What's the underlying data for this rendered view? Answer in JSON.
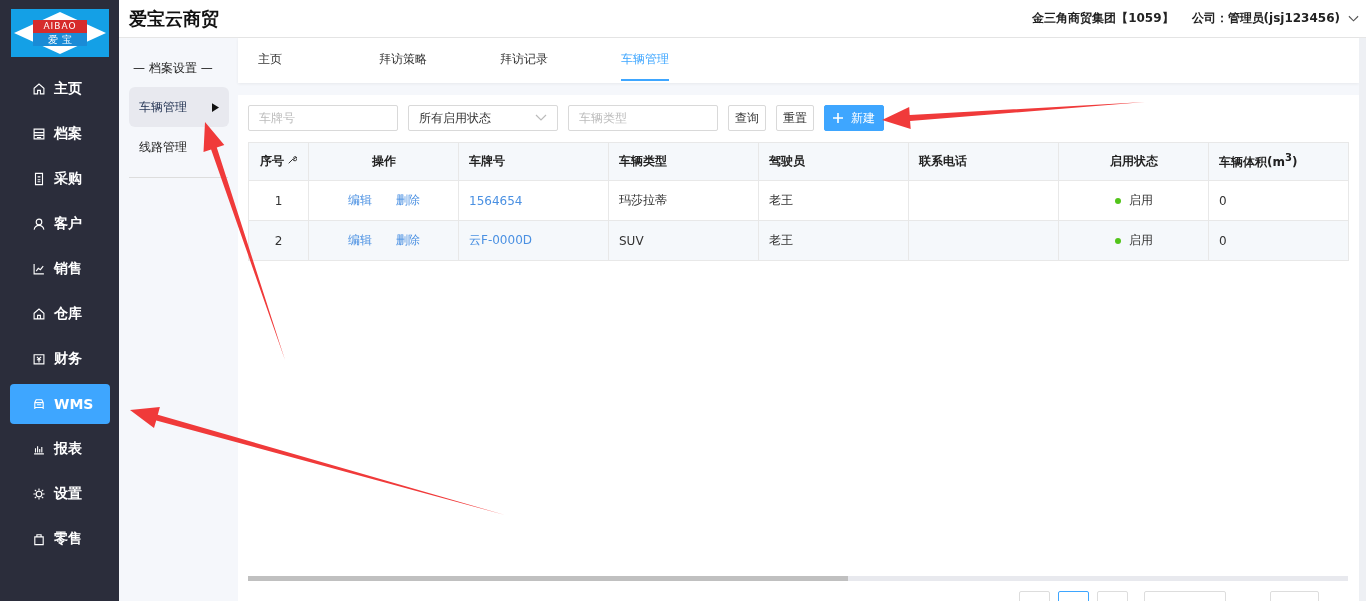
{
  "app_title": "爱宝云商贸",
  "logo": {
    "top": "AIBAO",
    "bottom": "爱 宝"
  },
  "header": {
    "company": "金三角商贸集团【1059】",
    "user": "公司：管理员(jsj123456)"
  },
  "nav": [
    {
      "label": "主页",
      "selected": false
    },
    {
      "label": "档案",
      "selected": false
    },
    {
      "label": "采购",
      "selected": false
    },
    {
      "label": "客户",
      "selected": false
    },
    {
      "label": "销售",
      "selected": false
    },
    {
      "label": "仓库",
      "selected": false
    },
    {
      "label": "财务",
      "selected": false
    },
    {
      "label": "WMS",
      "selected": true
    },
    {
      "label": "报表",
      "selected": false
    },
    {
      "label": "设置",
      "selected": false
    },
    {
      "label": "零售",
      "selected": false
    }
  ],
  "subnav": {
    "heading": "— 档案设置 —",
    "items": [
      {
        "label": "车辆管理",
        "selected": true
      },
      {
        "label": "线路管理",
        "selected": false
      }
    ]
  },
  "tabs": [
    {
      "label": "主页",
      "selected": false
    },
    {
      "label": "拜访策略",
      "selected": false
    },
    {
      "label": "拜访记录",
      "selected": false
    },
    {
      "label": "车辆管理",
      "selected": true
    }
  ],
  "filters": {
    "plate": {
      "placeholder": "车牌号"
    },
    "status": {
      "value": "所有启用状态"
    },
    "type": {
      "placeholder": "车辆类型"
    },
    "buttons": [
      "查询",
      "重置"
    ],
    "new_button": "新建"
  },
  "table": {
    "columns": [
      "序号",
      "操作",
      "车牌号",
      "车辆类型",
      "驾驶员",
      "联系电话",
      "启用状态",
      "车辆体积(m$^{3}$)"
    ],
    "rows": [
      {
        "index": "1",
        "actions": [
          "编辑",
          "删除"
        ],
        "plate": "1564654",
        "type": "玛莎拉蒂",
        "driver": "老王",
        "status": {
          "label": "启用",
          "color": "#52c41a"
        },
        "volume": "0"
      },
      {
        "index": "2",
        "actions": [
          "编辑",
          "删除"
        ],
        "plate": "云F-0000D",
        "type": "SUV",
        "driver": "老王",
        "status": {
          "label": "启用",
          "color": "#52c41a"
        },
        "volume": "0"
      }
    ]
  },
  "pager": [
    {
      "selected": false
    },
    {
      "selected": true
    },
    {
      "selected": false
    }
  ]
}
